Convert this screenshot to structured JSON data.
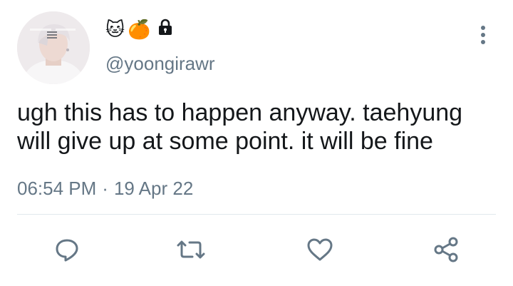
{
  "tweet": {
    "display_name_emoji": [
      "🐱",
      "🍊"
    ],
    "locked": true,
    "handle": "@yoongirawr",
    "text": "ugh this has to happen anyway. taehyung will give up at some point. it will be fine",
    "time": "06:54 PM",
    "separator": "·",
    "date": "19 Apr 22"
  },
  "icons": {
    "more": "more-vertical-icon",
    "reply": "reply-icon",
    "retweet": "retweet-icon",
    "like": "heart-icon",
    "share": "share-icon",
    "lock": "lock-icon"
  },
  "colors": {
    "text": "#14171a",
    "secondary": "#657786",
    "divider": "#e1e8ed",
    "icon": "#657786"
  }
}
